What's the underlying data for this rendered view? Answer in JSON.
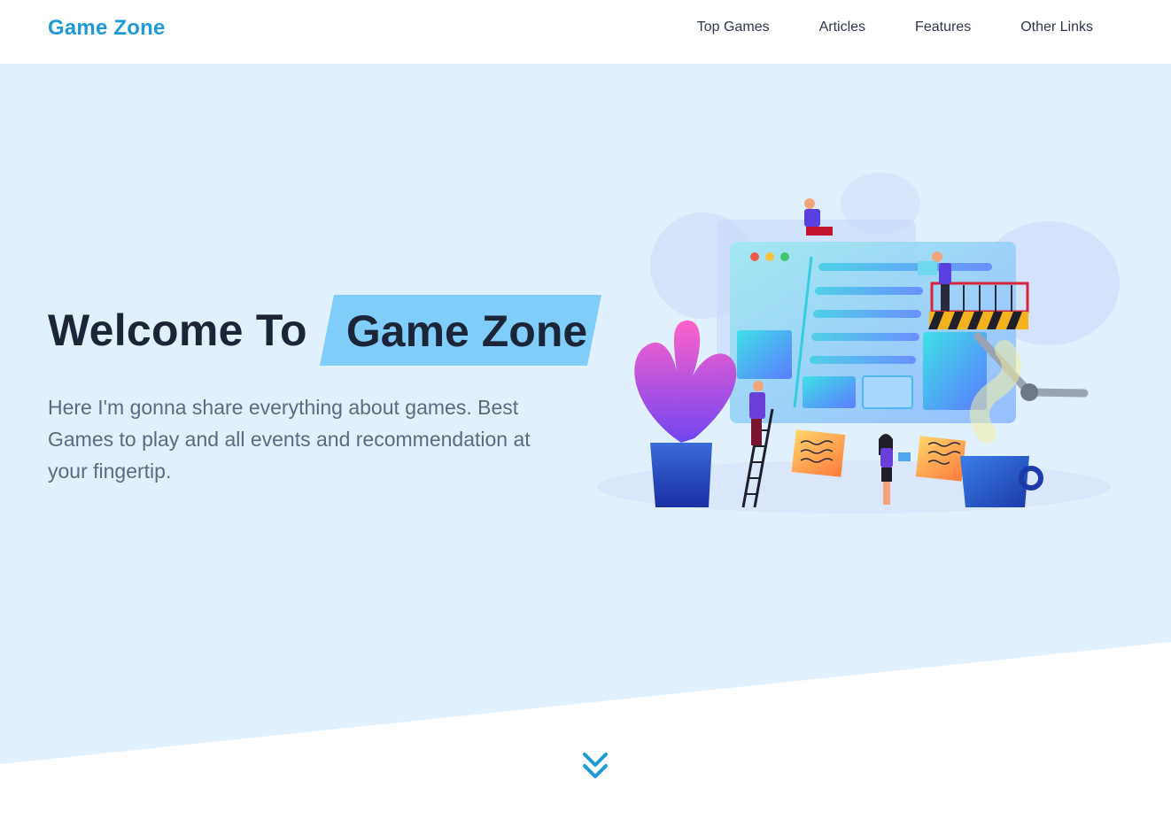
{
  "brand": {
    "name": "Game Zone",
    "color": "#1e9ad6"
  },
  "nav": {
    "items": [
      {
        "label": "Top Games"
      },
      {
        "label": "Articles"
      },
      {
        "label": "Features"
      },
      {
        "label": "Other Links"
      }
    ]
  },
  "hero": {
    "headline_plain": "Welcome To",
    "headline_highlight": "Game Zone",
    "subtitle": "Here I'm gonna share everything about games. Best Games to play and all events and recommendation at your fingertip.",
    "background_color": "#e1f0fd",
    "highlight_color": "#7fcdf8",
    "illustration_icon": "team-building-website-illustration"
  },
  "scroll_down": {
    "icon": "chevron-double-down-icon",
    "color": "#1e9ad6"
  }
}
